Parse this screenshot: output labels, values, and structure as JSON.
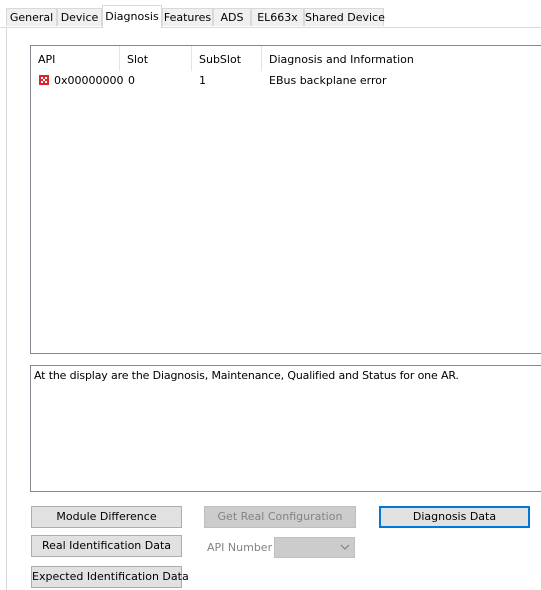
{
  "tabs": [
    {
      "label": "General",
      "active": false
    },
    {
      "label": "Device",
      "active": false
    },
    {
      "label": "Diagnosis",
      "active": true
    },
    {
      "label": "Features",
      "active": false
    },
    {
      "label": "ADS",
      "active": false
    },
    {
      "label": "EL663x",
      "active": false
    },
    {
      "label": "Shared Device",
      "active": false
    }
  ],
  "diagnosis_list": {
    "columns": [
      "API",
      "Slot",
      "SubSlot",
      "Diagnosis and Information"
    ],
    "rows": [
      {
        "icon": "error-icon",
        "api": "0x00000000",
        "slot": "0",
        "subslot": "1",
        "info": "EBus backplane error"
      }
    ]
  },
  "info_text": "At the display are the Diagnosis, Maintenance, Qualified and Status for one AR.",
  "buttons": {
    "module_difference": "Module Difference",
    "real_identification": "Real Identification Data",
    "expected_identification": "Expected Identification Data",
    "get_real_configuration": "Get Real Configuration",
    "diagnosis_data": "Diagnosis Data"
  },
  "api_number": {
    "label": "API Number",
    "value": ""
  },
  "colors": {
    "error": "#d9262b",
    "focus_border": "#0078d7"
  }
}
